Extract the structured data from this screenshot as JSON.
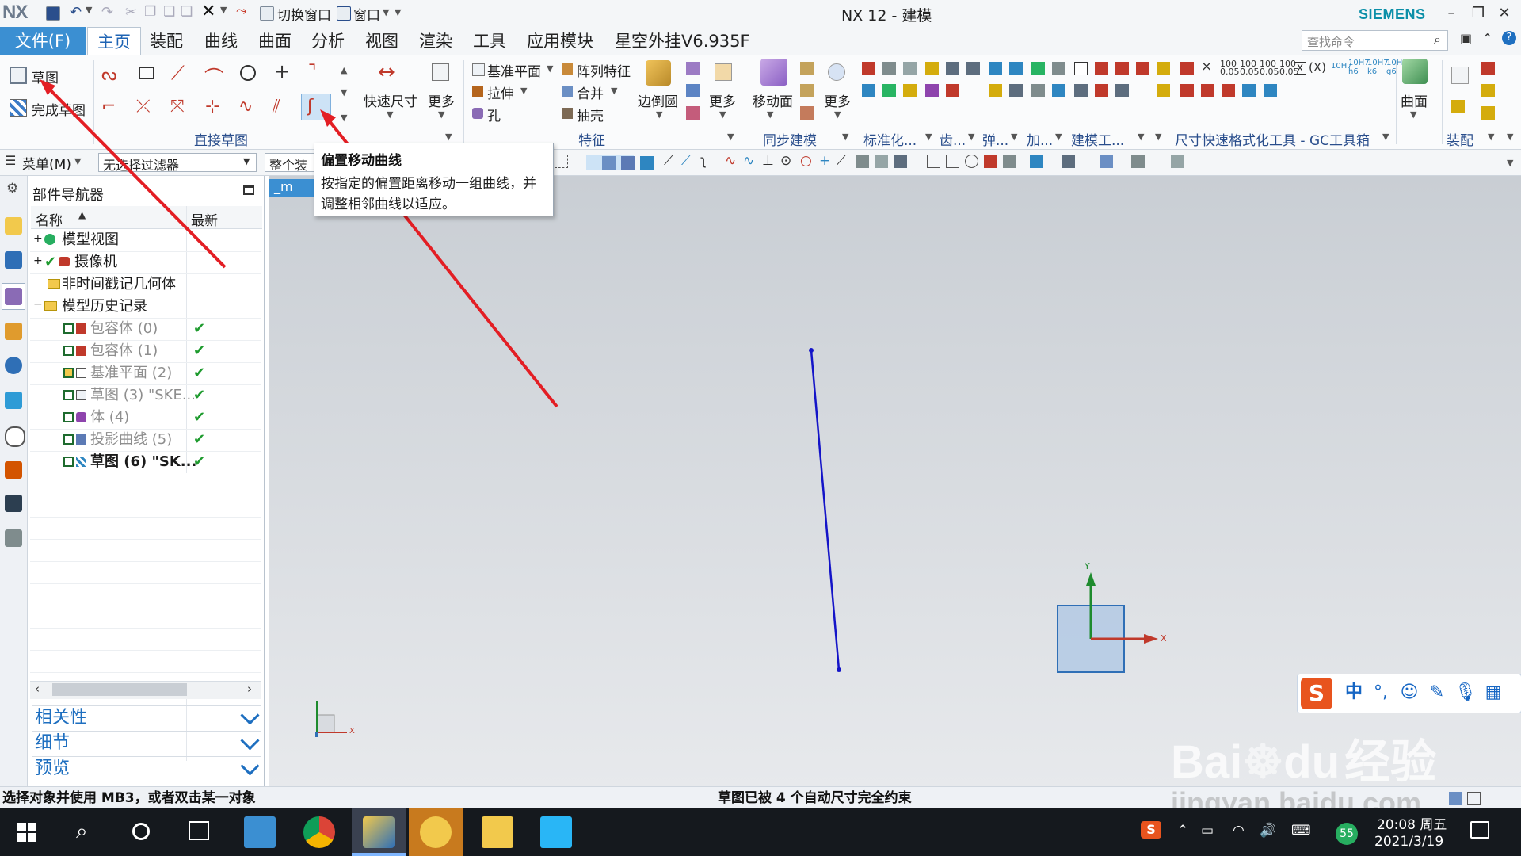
{
  "window": {
    "logo": "NX",
    "quick": [
      "切换窗口",
      "窗口"
    ],
    "title": "NX 12 - 建模",
    "brand": "SIEMENS"
  },
  "menubar": {
    "file": "文件(F)",
    "tabs": [
      "主页",
      "装配",
      "曲线",
      "曲面",
      "分析",
      "视图",
      "渲染",
      "工具",
      "应用模块",
      "星空外挂V6.935F"
    ],
    "search_placeholder": "查找命令"
  },
  "ribbon": {
    "sketch": "草图",
    "finish_sketch": "完成草图",
    "group_direct_sketch": "直接草图",
    "quick_dim": "快速尺寸",
    "more": "更多",
    "datum_plane": "基准平面",
    "extrude": "拉伸",
    "hole": "孔",
    "pattern_feature": "阵列特征",
    "unite": "合并",
    "shell": "抽壳",
    "edge_blend": "边倒圆",
    "group_feature": "特征",
    "move_face": "移动面",
    "group_sync": "同步建模",
    "group_standard": "标准化...",
    "group_gear": "齿...",
    "group_spring": "弹...",
    "group_add": "加...",
    "group_modeling_tools": "建模工...",
    "group_dim_format": "尺寸快速格式化工具 - GC工具箱",
    "surface": "曲面",
    "group_assembly": "装配"
  },
  "toolbar": {
    "menu": "菜单(M)",
    "filter": "无选择过滤器",
    "assembly_scope": "整个装配"
  },
  "tooltip": {
    "title": "偏置移动曲线",
    "body": "按指定的偏置距离移动一组曲线，并调整相邻曲线以适应。"
  },
  "navigator": {
    "title": "部件导航器",
    "col_name": "名称",
    "col_latest": "最新",
    "rows": [
      {
        "label": "模型视图"
      },
      {
        "label": "摄像机"
      },
      {
        "label": "非时间戳记几何体"
      },
      {
        "label": "模型历史记录"
      },
      {
        "label": "包容体 (0)"
      },
      {
        "label": "包容体 (1)"
      },
      {
        "label": "基准平面 (2)"
      },
      {
        "label": "草图 (3) \"SKE..."
      },
      {
        "label": "体 (4)"
      },
      {
        "label": "投影曲线 (5)"
      },
      {
        "label": "草图 (6) \"SK..."
      }
    ],
    "sections": [
      "相关性",
      "细节",
      "预览"
    ]
  },
  "graphics": {
    "tab": "_m",
    "axis_x": "X",
    "axis_y": "Y"
  },
  "status": {
    "left": "选择对象并使用 MB3，或者双击某一对象",
    "center": "草图已被 4 个自动尺寸完全约束"
  },
  "ime": {
    "lang": "中"
  },
  "watermark": {
    "brand": "Bai",
    "brand2": "du",
    "brand3": "经验",
    "url": "jingyan.baidu.com"
  },
  "taskbar": {
    "battery": "55",
    "time": "20:08 周五",
    "date": "2021/3/19"
  }
}
